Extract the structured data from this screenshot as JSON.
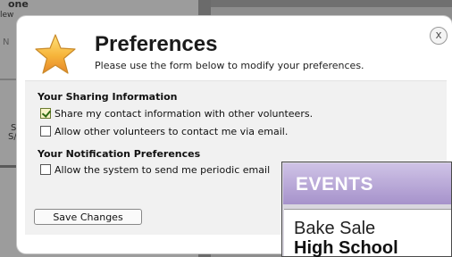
{
  "background": {
    "page_title_fragment": "one",
    "text_fragment_1": "lew",
    "text_fragment_2": "N",
    "text_fragment_3": "S",
    "text_fragment_4": "S/"
  },
  "modal": {
    "title": "Preferences",
    "subtitle": "Please use the form below to modify your preferences.",
    "close_label": "x",
    "sharing": {
      "heading": "Your Sharing Information",
      "options": [
        {
          "label": "Share my contact information with other volunteers.",
          "checked": true
        },
        {
          "label": "Allow other volunteers to contact me via email.",
          "checked": false
        }
      ]
    },
    "notification": {
      "heading": "Your Notification Preferences",
      "options": [
        {
          "label": "Allow the system to send me periodic email",
          "checked": false
        }
      ]
    },
    "save_label": "Save Changes"
  },
  "events": {
    "title": "EVENTS",
    "items": [
      "Bake Sale",
      "High School"
    ]
  },
  "colors": {
    "events_header": "#a692cb",
    "check_mark": "#2f6a12"
  }
}
